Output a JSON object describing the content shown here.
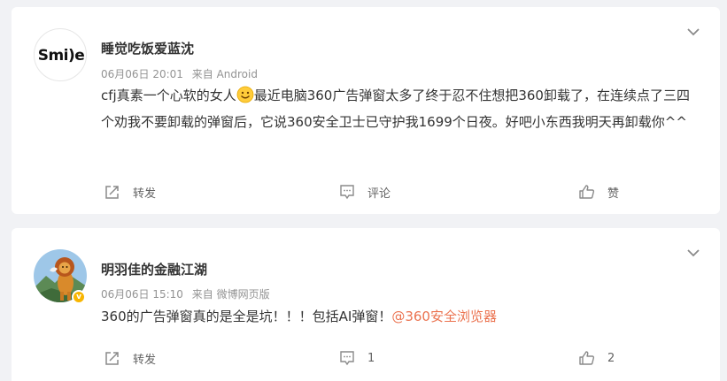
{
  "posts": [
    {
      "username": "睡觉吃饭爱蓝沈",
      "avatar_text": "Smi)e",
      "date": "06月06日 20:01",
      "source": "来自 Android",
      "content_before_emoji": "cfj真素一个心软的女人",
      "emoji": "smile-emoji",
      "content_after_emoji": "最近电脑360广告弹窗太多了终于忍不住想把360卸载了，在连续点了三四个劝我不要卸载的弹窗后，它说360安全卫士已守护我1699个日夜。好吧小东西我明天再卸载你^^",
      "actions": {
        "repost": "转发",
        "comment": "评论",
        "like": "赞"
      }
    },
    {
      "username": "明羽佳的金融江湖",
      "verified_badge": "v",
      "date": "06月06日 15:10",
      "source": "来自 微博网页版",
      "content_text": "360的广告弹窗真的是全是坑！！！包括AI弹窗！",
      "mention": "@360安全浏览器",
      "actions": {
        "repost": "转发",
        "comment": "1",
        "like": "2"
      }
    }
  ],
  "icons": {
    "menu": "chevron-down-icon",
    "repost": "repost-icon",
    "comment": "comment-icon",
    "like": "thumbs-up-icon"
  },
  "colors": {
    "background": "#f1f2f5",
    "card": "#ffffff",
    "mention": "#eb7350",
    "meta": "#939393",
    "badge": "#f8b500"
  }
}
